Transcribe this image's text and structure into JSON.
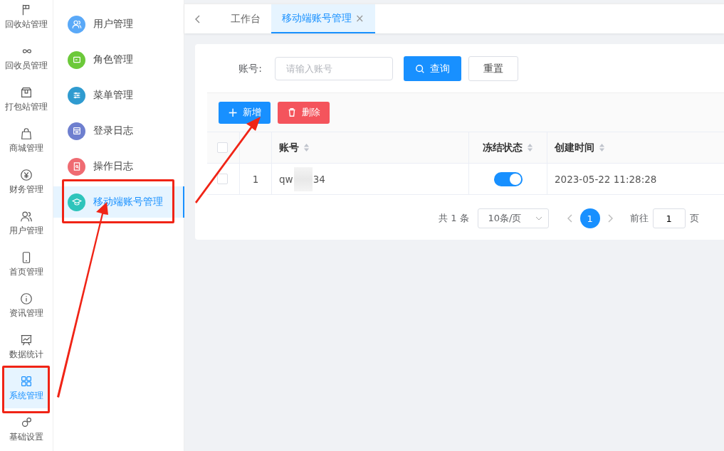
{
  "rail": {
    "items": [
      {
        "label": "回收站管理",
        "selected": false
      },
      {
        "label": "回收员管理",
        "selected": false
      },
      {
        "label": "打包站管理",
        "selected": false
      },
      {
        "label": "商城管理",
        "selected": false
      },
      {
        "label": "财务管理",
        "selected": false
      },
      {
        "label": "用户管理",
        "selected": false
      },
      {
        "label": "首页管理",
        "selected": false
      },
      {
        "label": "资讯管理",
        "selected": false
      },
      {
        "label": "数据统计",
        "selected": false
      },
      {
        "label": "系统管理",
        "selected": true
      },
      {
        "label": "基础设置",
        "selected": false
      }
    ]
  },
  "submenu": {
    "items": [
      {
        "label": "用户管理",
        "color": "#5aa9f8",
        "selected": false
      },
      {
        "label": "角色管理",
        "color": "#6cc93a",
        "selected": false
      },
      {
        "label": "菜单管理",
        "color": "#2f9bd0",
        "selected": false
      },
      {
        "label": "登录日志",
        "color": "#6e7fcf",
        "selected": false
      },
      {
        "label": "操作日志",
        "color": "#ef6b72",
        "selected": false
      },
      {
        "label": "移动端账号管理",
        "color": "#2ec4bb",
        "selected": true
      }
    ]
  },
  "tabs": [
    {
      "label": "工作台",
      "selected": false
    },
    {
      "label": "移动端账号管理",
      "selected": true,
      "close": "×"
    }
  ],
  "search": {
    "label": "账号:",
    "placeholder": "请输入账号",
    "query_button": "查询",
    "reset_button": "重置"
  },
  "toolbar": {
    "add_icon": "+",
    "add_button": "新增",
    "delete_button": "删除"
  },
  "table": {
    "all_checked": false,
    "columns": [
      "账号",
      "冻结状态",
      "创建时间"
    ],
    "rows": [
      {
        "index": "1",
        "account_start": "qw",
        "account_end": "34",
        "frozen": true,
        "checked": false,
        "created": "2023-05-22 11:28:28"
      }
    ]
  },
  "pagination": {
    "total": "共 1 条",
    "page_size": "10条/页",
    "pages": [
      {
        "label": "1",
        "selected": true
      }
    ],
    "goto_label": "前往",
    "goto_value": "1",
    "goto_suffix": "页"
  }
}
